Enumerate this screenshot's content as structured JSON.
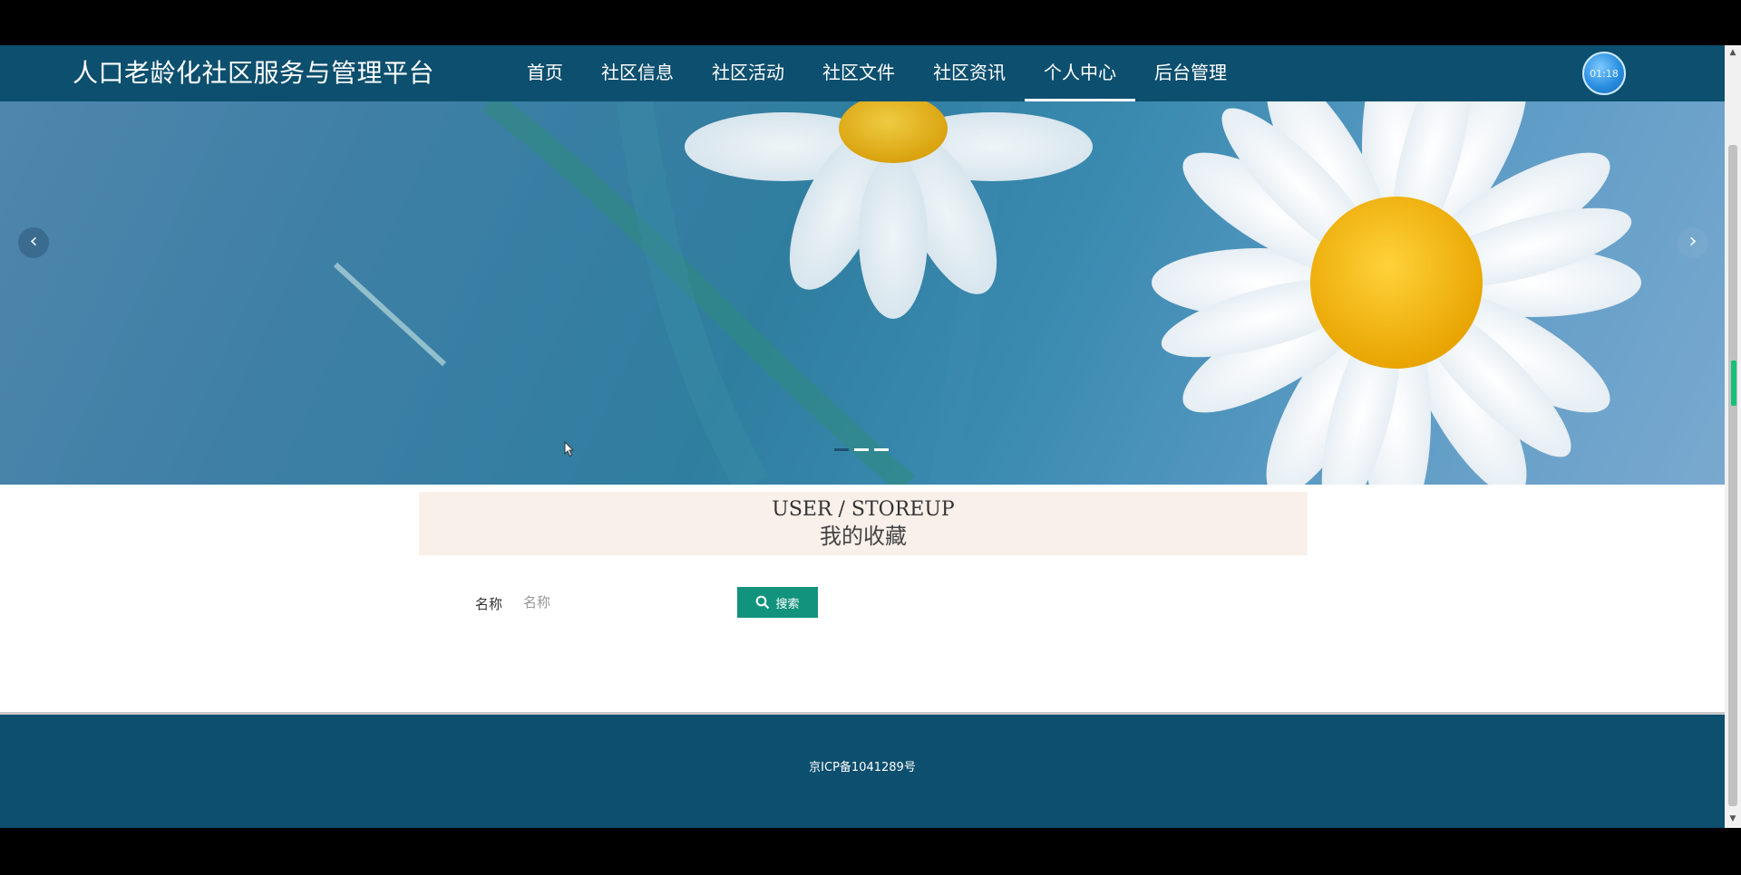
{
  "header": {
    "site_title": "人口老龄化社区服务与管理平台",
    "nav": [
      {
        "label": "首页",
        "active": false
      },
      {
        "label": "社区信息",
        "active": false
      },
      {
        "label": "社区活动",
        "active": false
      },
      {
        "label": "社区文件",
        "active": false
      },
      {
        "label": "社区资讯",
        "active": false
      },
      {
        "label": "个人中心",
        "active": true
      },
      {
        "label": "后台管理",
        "active": false
      }
    ],
    "avatar_icon": "avatar-icon",
    "avatar_text": "01:18"
  },
  "banner": {
    "prev_label": "‹",
    "next_label": "›",
    "slides_total": 3,
    "active_slide": 2
  },
  "section": {
    "title_en": "USER / STOREUP",
    "title_cn": "我的收藏"
  },
  "search": {
    "label": "名称",
    "placeholder": "名称",
    "value": "",
    "button_label": "搜索",
    "button_icon": "search-icon"
  },
  "footer": {
    "text": "京ICP备1041289号"
  },
  "colors": {
    "nav_bg": "#0d4f6e",
    "button_bg": "#12937d",
    "section_bg": "#faf0ea",
    "footer_bg": "#0d4f6e"
  }
}
